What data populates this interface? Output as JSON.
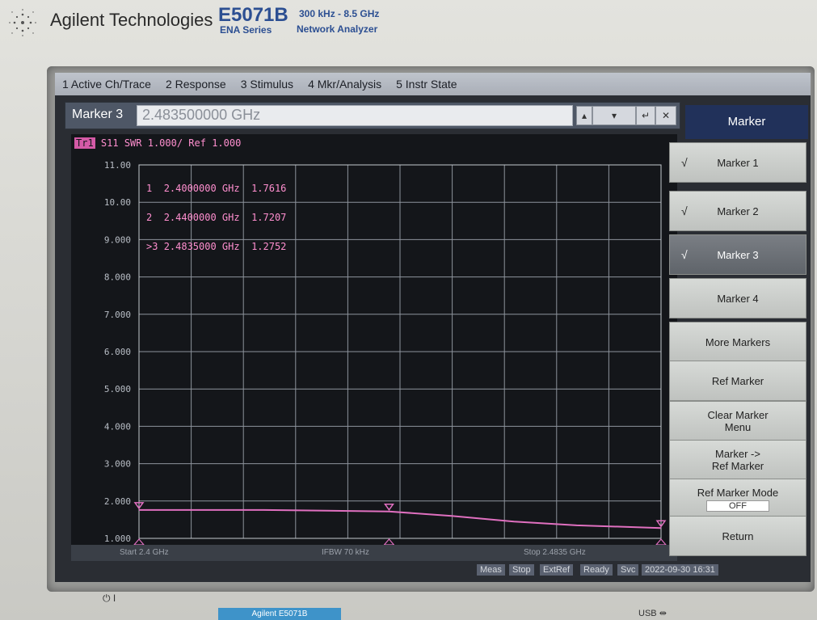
{
  "device": {
    "brand": "Agilent Technologies",
    "model": "E5071B",
    "series": "ENA Series",
    "frequency_range": "300 kHz - 8.5 GHz",
    "analyzer_name": "Network Analyzer",
    "badge": "Agilent  E5071B",
    "power_label": "⏻ I",
    "usb_label": "USB"
  },
  "menubar": {
    "items": [
      "1 Active Ch/Trace",
      "2 Response",
      "3 Stimulus",
      "4 Mkr/Analysis",
      "5 Instr State"
    ]
  },
  "entry": {
    "label": "Marker 3",
    "value": "2.483500000 GHz"
  },
  "trace": {
    "tag": "Tr1",
    "header": "S11  SWR 1.000/ Ref 1.000"
  },
  "chart_data": {
    "type": "line",
    "title": "",
    "xlabel": "",
    "ylabel": "",
    "x_start_label": "Start 2.4 GHz",
    "x_stop_label": "Stop 2.4835 GHz",
    "ifbw_label": "IFBW 70 kHz",
    "y_ticks": [
      "11.00",
      "10.00",
      "9.000",
      "8.000",
      "7.000",
      "6.000",
      "5.000",
      "4.000",
      "3.000",
      "2.000",
      "1.000"
    ],
    "ylim": [
      1,
      11
    ],
    "xlim": [
      2.4,
      2.4835
    ],
    "grid": true,
    "series": [
      {
        "x": [
          2.4,
          2.41,
          2.42,
          2.43,
          2.44,
          2.45,
          2.46,
          2.47,
          2.4835
        ],
        "values": [
          1.7616,
          1.7616,
          1.76,
          1.74,
          1.7207,
          1.6,
          1.45,
          1.35,
          1.2752
        ]
      }
    ],
    "markers": [
      {
        "id": "1",
        "freq": "2.4000000 GHz",
        "value": "1.7616"
      },
      {
        "id": "2",
        "freq": "2.4400000 GHz",
        "value": "1.7207"
      },
      {
        "id": ">3",
        "freq": "2.4835000 GHz",
        "value": "1.2752"
      }
    ],
    "marker_x": [
      2.4,
      2.44,
      2.4835
    ],
    "marker_y": [
      1.7616,
      1.7207,
      1.2752
    ],
    "trace_color": "#e070c0"
  },
  "softkeys": {
    "title": "Marker",
    "items": [
      {
        "label": "Marker 1",
        "check": "√",
        "active": false
      },
      {
        "label": "Marker 2",
        "check": "√",
        "active": false
      },
      {
        "label": "Marker 3",
        "check": "√",
        "active": true
      },
      {
        "label": "Marker 4",
        "check": "",
        "active": false
      },
      {
        "label": "More Markers",
        "check": "",
        "active": false
      },
      {
        "label": "Ref Marker",
        "check": "",
        "active": false
      },
      {
        "label": "Clear Marker\nMenu",
        "check": "",
        "active": false
      },
      {
        "label": "Marker ->\nRef Marker",
        "check": "",
        "active": false
      },
      {
        "label": "Ref Marker Mode",
        "check": "",
        "active": false,
        "sub": "OFF"
      },
      {
        "label": "Return",
        "check": "",
        "active": false
      }
    ]
  },
  "status": {
    "items": [
      "Meas",
      "Stop",
      "ExtRef",
      "Ready",
      "Svc",
      "2022-09-30 16:31"
    ]
  }
}
